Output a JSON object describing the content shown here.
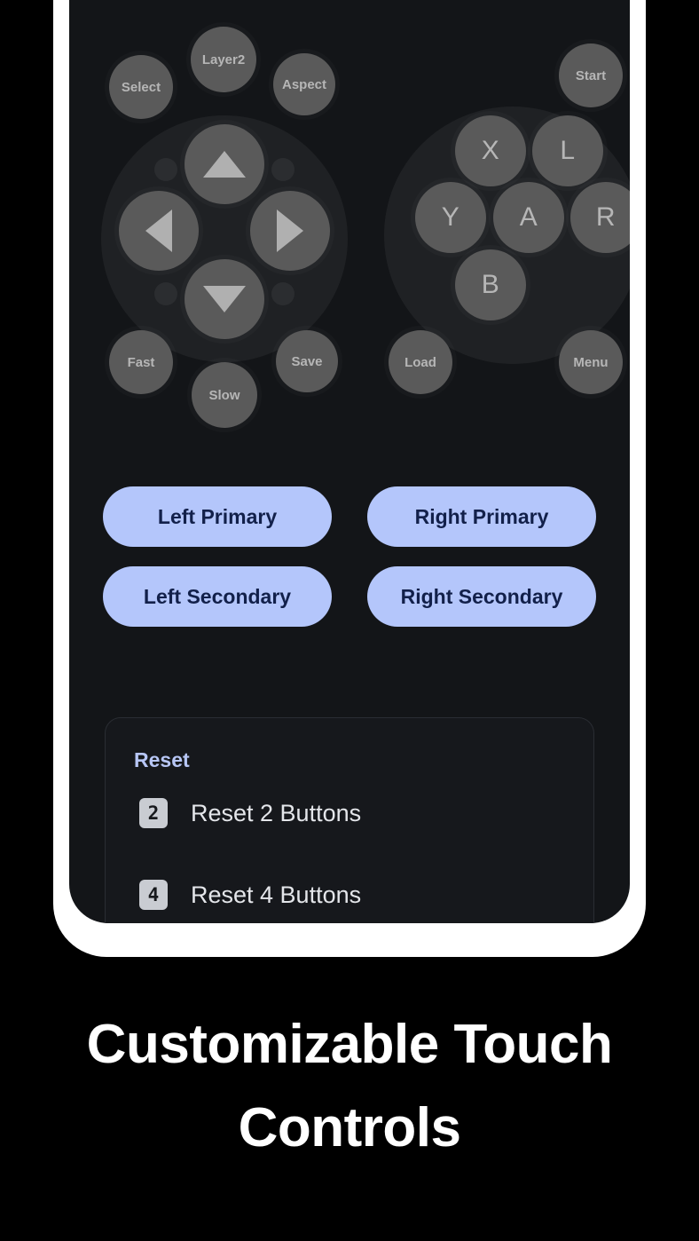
{
  "caption": {
    "line1": "Customizable Touch",
    "line2": "Controls"
  },
  "gamepad": {
    "left_cluster": {
      "top_buttons": [
        {
          "label": "Select",
          "name": "select-button"
        },
        {
          "label": "Layer2",
          "name": "layer2-button"
        },
        {
          "label": "Aspect",
          "name": "aspect-button"
        }
      ],
      "dpad": [
        {
          "label": "up",
          "name": "dpad-up-button"
        },
        {
          "label": "left",
          "name": "dpad-left-button"
        },
        {
          "label": "right",
          "name": "dpad-right-button"
        },
        {
          "label": "down",
          "name": "dpad-down-button"
        }
      ],
      "bottom_buttons": [
        {
          "label": "Fast",
          "name": "fast-button"
        },
        {
          "label": "Slow",
          "name": "slow-button"
        },
        {
          "label": "Save",
          "name": "save-button"
        }
      ]
    },
    "right_cluster": {
      "top_buttons": [
        {
          "label": "Start",
          "name": "start-button"
        }
      ],
      "face_buttons": [
        {
          "label": "X",
          "name": "x-button"
        },
        {
          "label": "L",
          "name": "l-button"
        },
        {
          "label": "Y",
          "name": "y-button"
        },
        {
          "label": "A",
          "name": "a-button"
        },
        {
          "label": "R",
          "name": "r-button"
        },
        {
          "label": "B",
          "name": "b-button"
        }
      ],
      "bottom_buttons": [
        {
          "label": "Load",
          "name": "load-button"
        },
        {
          "label": "Menu",
          "name": "menu-button"
        }
      ]
    }
  },
  "assign_buttons": [
    {
      "label": "Left Primary",
      "name": "left-primary-button"
    },
    {
      "label": "Right Primary",
      "name": "right-primary-button"
    },
    {
      "label": "Left Secondary",
      "name": "left-secondary-button"
    },
    {
      "label": "Right Secondary",
      "name": "right-secondary-button"
    }
  ],
  "reset_section": {
    "title": "Reset",
    "items": [
      {
        "key": "2",
        "label": "Reset 2 Buttons"
      },
      {
        "key": "4",
        "label": "Reset 4 Buttons"
      }
    ]
  },
  "colors": {
    "screen_background": "#131518",
    "frame": "#ffffff",
    "page_background": "#000000",
    "accent_blue": "#b4c6fb",
    "accent_blue_text": "#12204a",
    "reset_title": "#b7c6f5",
    "pad_button": "#5a5a5a",
    "pad_label": "#b6b6b6",
    "keycap": "#c9ccd2"
  }
}
